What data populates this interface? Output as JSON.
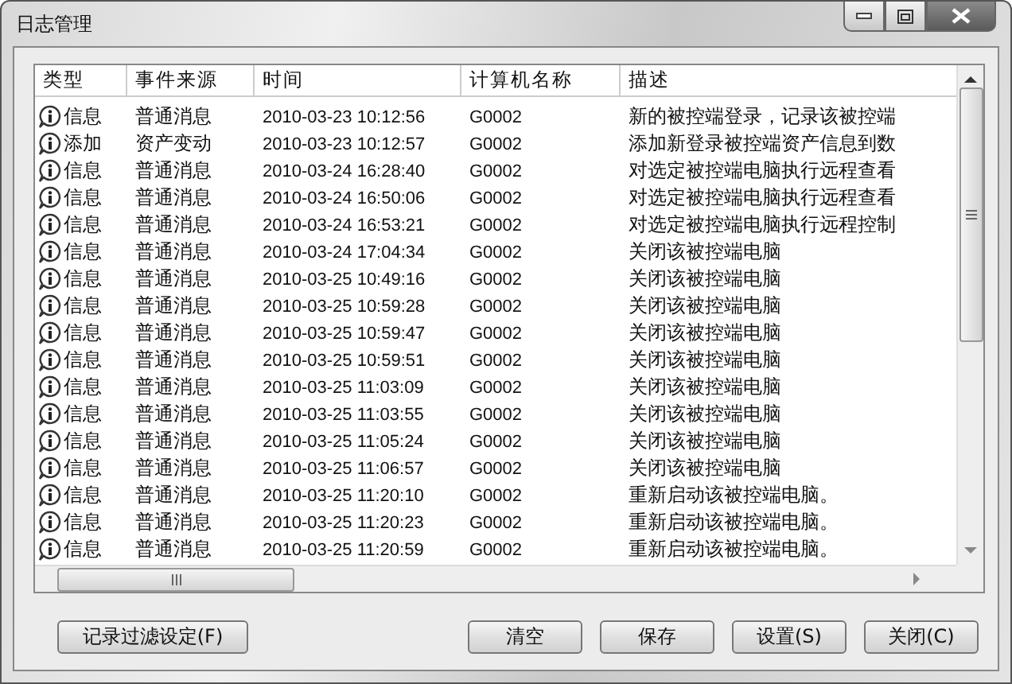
{
  "window": {
    "title": "日志管理"
  },
  "table": {
    "columns": [
      "类型",
      "事件来源",
      "时间",
      "计算机名称",
      "描述"
    ],
    "rows": [
      {
        "type": "信息",
        "source": "普通消息",
        "time": "2010-03-23 10:12:56",
        "computer": "G0002",
        "description": "新的被控端登录，记录该被控端"
      },
      {
        "type": "添加",
        "source": "资产变动",
        "time": "2010-03-23 10:12:57",
        "computer": "G0002",
        "description": "添加新登录被控端资产信息到数"
      },
      {
        "type": "信息",
        "source": "普通消息",
        "time": "2010-03-24 16:28:40",
        "computer": "G0002",
        "description": "对选定被控端电脑执行远程查看"
      },
      {
        "type": "信息",
        "source": "普通消息",
        "time": "2010-03-24 16:50:06",
        "computer": "G0002",
        "description": "对选定被控端电脑执行远程查看"
      },
      {
        "type": "信息",
        "source": "普通消息",
        "time": "2010-03-24 16:53:21",
        "computer": "G0002",
        "description": "对选定被控端电脑执行远程控制"
      },
      {
        "type": "信息",
        "source": "普通消息",
        "time": "2010-03-24 17:04:34",
        "computer": "G0002",
        "description": "关闭该被控端电脑"
      },
      {
        "type": "信息",
        "source": "普通消息",
        "time": "2010-03-25 10:49:16",
        "computer": "G0002",
        "description": "关闭该被控端电脑"
      },
      {
        "type": "信息",
        "source": "普通消息",
        "time": "2010-03-25 10:59:28",
        "computer": "G0002",
        "description": "关闭该被控端电脑"
      },
      {
        "type": "信息",
        "source": "普通消息",
        "time": "2010-03-25 10:59:47",
        "computer": "G0002",
        "description": "关闭该被控端电脑"
      },
      {
        "type": "信息",
        "source": "普通消息",
        "time": "2010-03-25 10:59:51",
        "computer": "G0002",
        "description": "关闭该被控端电脑"
      },
      {
        "type": "信息",
        "source": "普通消息",
        "time": "2010-03-25 11:03:09",
        "computer": "G0002",
        "description": "关闭该被控端电脑"
      },
      {
        "type": "信息",
        "source": "普通消息",
        "time": "2010-03-25 11:03:55",
        "computer": "G0002",
        "description": "关闭该被控端电脑"
      },
      {
        "type": "信息",
        "source": "普通消息",
        "time": "2010-03-25 11:05:24",
        "computer": "G0002",
        "description": "关闭该被控端电脑"
      },
      {
        "type": "信息",
        "source": "普通消息",
        "time": "2010-03-25 11:06:57",
        "computer": "G0002",
        "description": "关闭该被控端电脑"
      },
      {
        "type": "信息",
        "source": "普通消息",
        "time": "2010-03-25 11:20:10",
        "computer": "G0002",
        "description": "重新启动该被控端电脑。"
      },
      {
        "type": "信息",
        "source": "普通消息",
        "time": "2010-03-25 11:20:23",
        "computer": "G0002",
        "description": "重新启动该被控端电脑。"
      },
      {
        "type": "信息",
        "source": "普通消息",
        "time": "2010-03-25 11:20:59",
        "computer": "G0002",
        "description": "重新启动该被控端电脑。"
      }
    ]
  },
  "buttons_left": [
    "记录过滤设定(F)"
  ],
  "buttons_right": [
    "清空",
    "保存",
    "设置(S)",
    "关闭(C)"
  ]
}
